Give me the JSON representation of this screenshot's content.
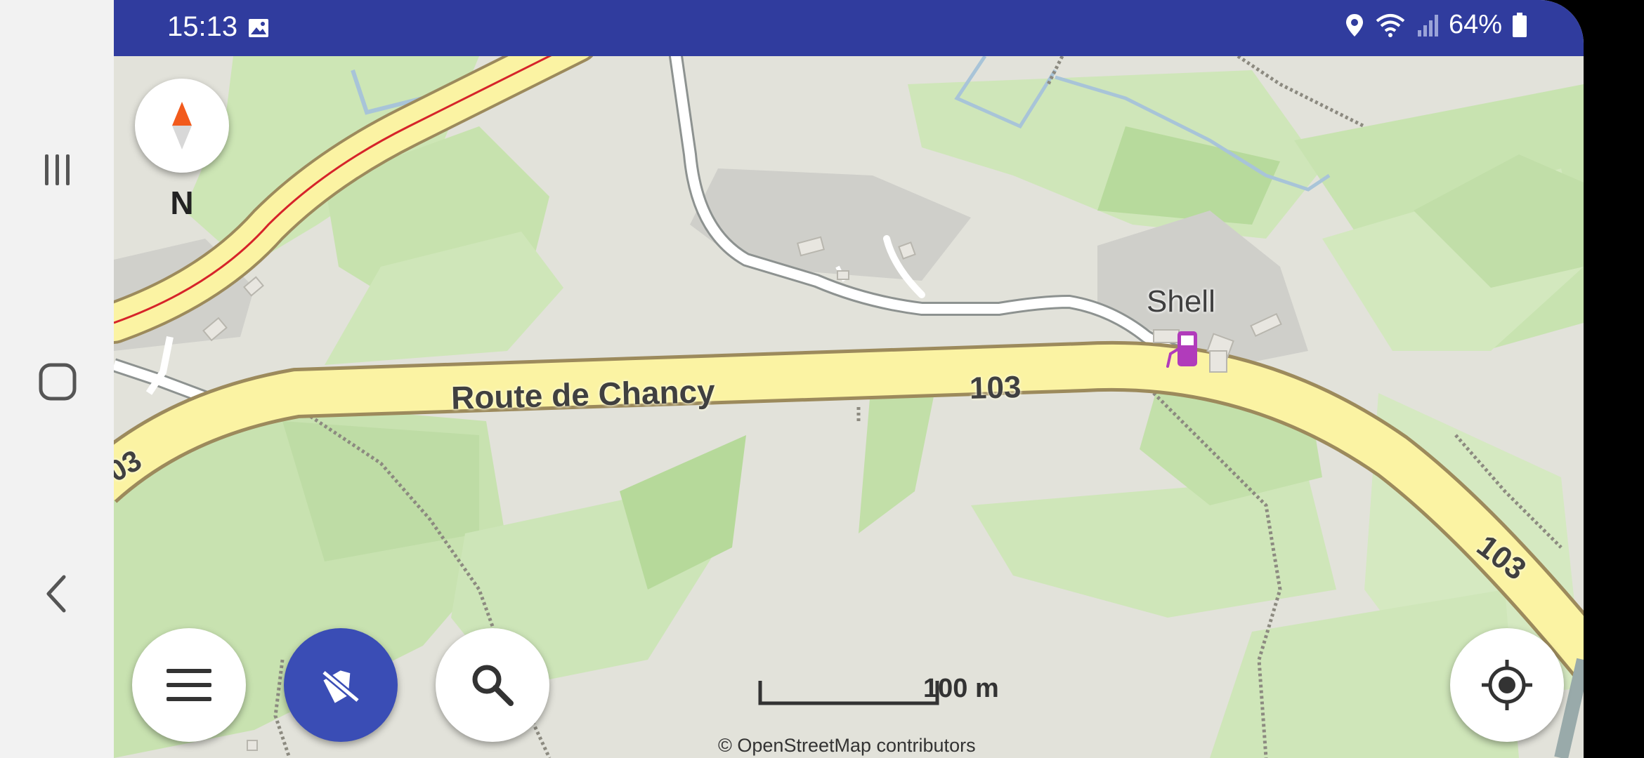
{
  "status_bar": {
    "time": "15:13",
    "battery": "64%",
    "icons": [
      "gallery-icon",
      "location-icon",
      "wifi-icon",
      "signal-icon",
      "battery-icon"
    ]
  },
  "map": {
    "road_name": "Route de Chancy",
    "road_number": "103",
    "road_number_left": "03",
    "poi": {
      "name": "Shell",
      "icon": "fuel-station-icon"
    },
    "compass_label": "N",
    "scale": "100 m",
    "attribution": "© OpenStreetMap contributors"
  },
  "controls": {
    "menu": "menu-icon",
    "layers": "no-route-icon",
    "search": "search-icon",
    "locate": "my-location-icon"
  },
  "colors": {
    "status_bar": "#303c9e",
    "fab_blue": "#3a4db5",
    "main_road": "#fbf3a3",
    "poi": "#b13bbb"
  }
}
